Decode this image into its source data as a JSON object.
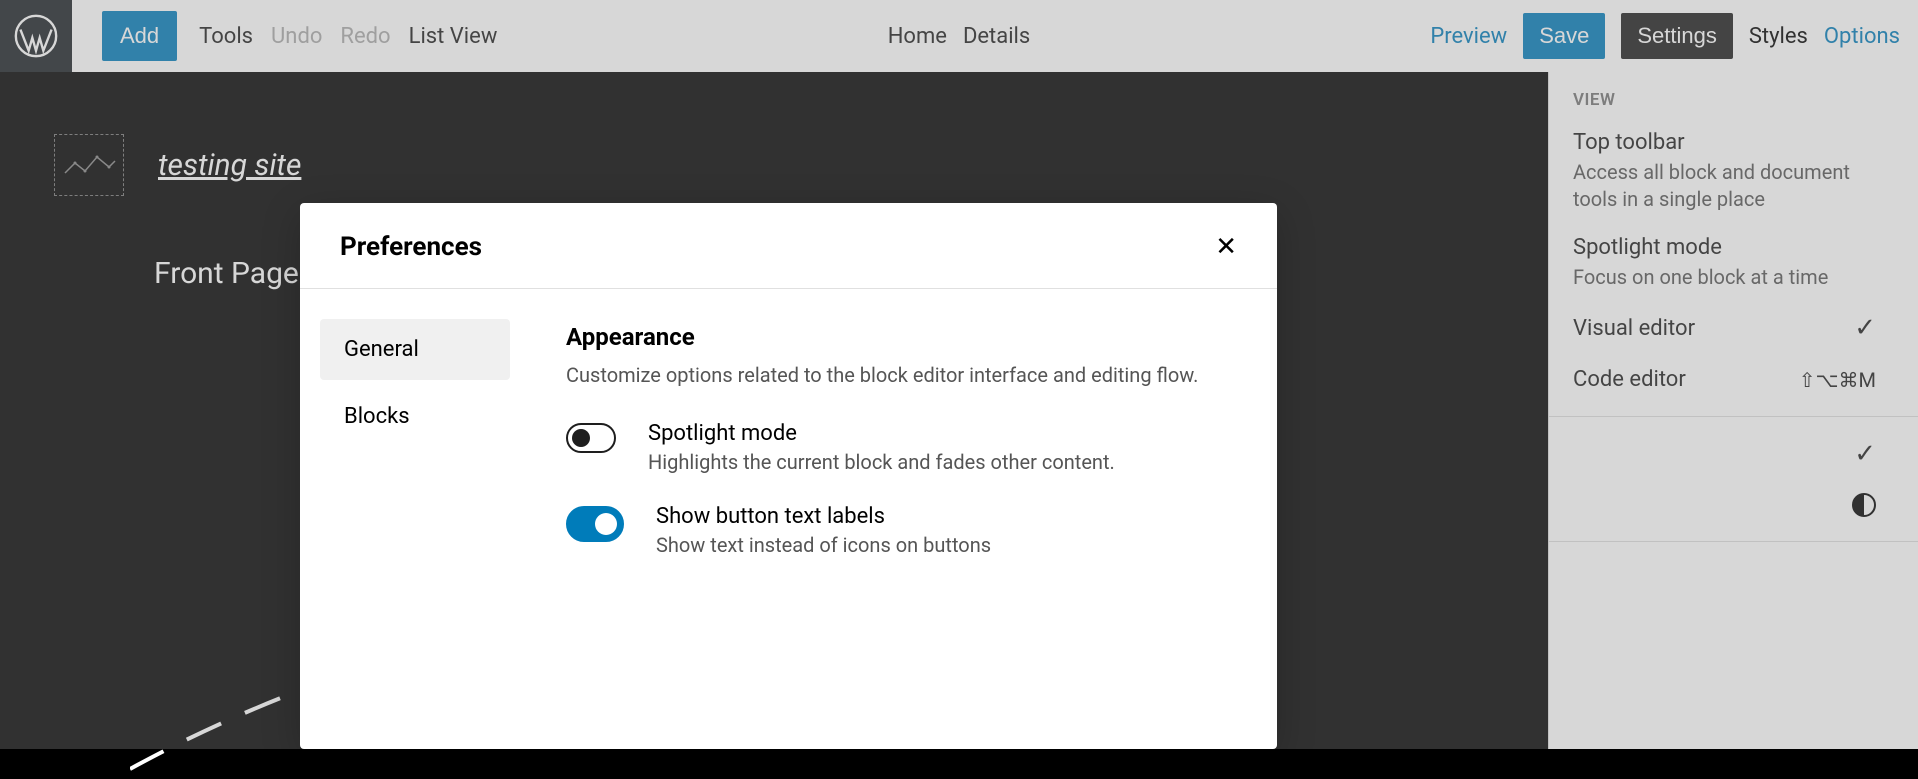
{
  "toolbar": {
    "add_label": "Add",
    "tools_label": "Tools",
    "undo_label": "Undo",
    "redo_label": "Redo",
    "listview_label": "List View",
    "home_label": "Home",
    "details_label": "Details",
    "preview_label": "Preview",
    "save_label": "Save",
    "settings_label": "Settings",
    "styles_label": "Styles",
    "options_label": "Options"
  },
  "canvas": {
    "site_title": "testing site",
    "page_name": "Front Page"
  },
  "options": {
    "section_label": "View",
    "items": [
      {
        "title": "Top toolbar",
        "desc": "Access all block and document tools in a single place"
      },
      {
        "title": "Spotlight mode",
        "desc": "Focus on one block at a time"
      }
    ],
    "rows": [
      {
        "title": "Visual editor",
        "check": true
      },
      {
        "title": "Code editor",
        "shortcut": "⇧⌥⌘M"
      }
    ],
    "extra": [
      {
        "check": true
      },
      {
        "contrast": true
      }
    ]
  },
  "modal": {
    "title": "Preferences",
    "tabs": [
      {
        "label": "General",
        "active": true
      },
      {
        "label": "Blocks",
        "active": false
      }
    ],
    "panel": {
      "heading": "Appearance",
      "subtitle": "Customize options related to the block editor interface and editing flow.",
      "prefs": [
        {
          "label": "Spotlight mode",
          "desc": "Highlights the current block and fades other content.",
          "on": false
        },
        {
          "label": "Show button text labels",
          "desc": "Show text instead of icons on buttons",
          "on": true
        }
      ]
    }
  }
}
